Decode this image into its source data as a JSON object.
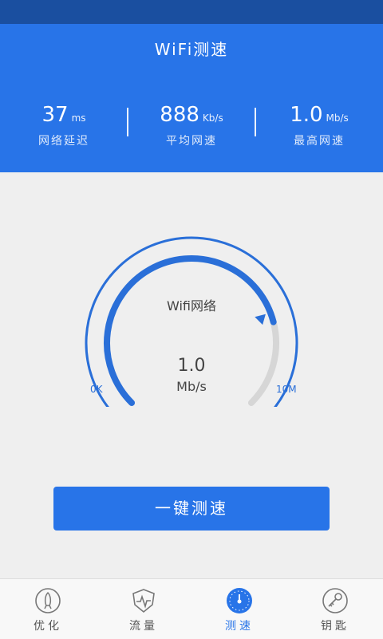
{
  "header": {
    "title": "WiFi测速",
    "stats": [
      {
        "value": "37",
        "unit": "ms",
        "label": "网络延迟"
      },
      {
        "value": "888",
        "unit": "Kb/s",
        "label": "平均网速"
      },
      {
        "value": "1.0",
        "unit": "Mb/s",
        "label": "最高网速"
      }
    ]
  },
  "gauge": {
    "network_label": "Wifi网络",
    "speed_value": "1.0",
    "speed_unit": "Mb/s",
    "min_label": "0K",
    "max_label": "10M",
    "progress": 0.78,
    "color_active": "#2a6fd8",
    "color_track": "#d6d6d6"
  },
  "button": {
    "label": "一键测速"
  },
  "tabs": [
    {
      "label": "优化",
      "icon": "rocket-icon"
    },
    {
      "label": "流量",
      "icon": "pulse-shield-icon"
    },
    {
      "label": "测速",
      "icon": "speedometer-icon"
    },
    {
      "label": "钥匙",
      "icon": "key-icon"
    }
  ]
}
